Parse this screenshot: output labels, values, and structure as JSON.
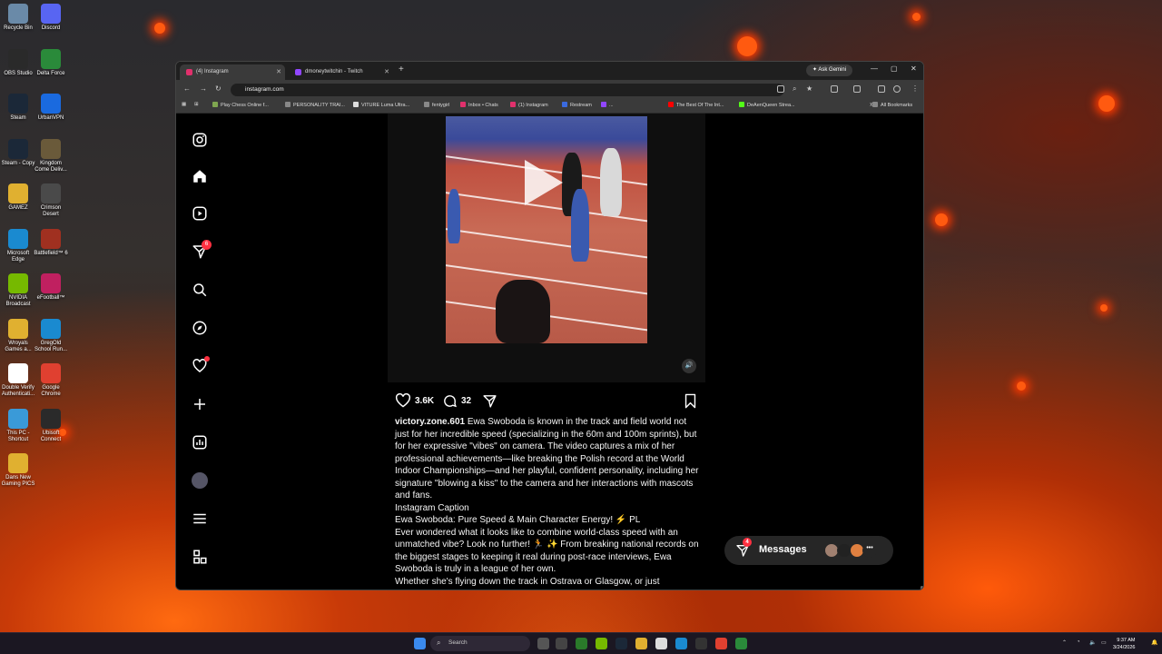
{
  "desktop": {
    "icons": [
      {
        "label": "Recycle Bin",
        "color": "#6a8aa8"
      },
      {
        "label": "Discord",
        "color": "#5865f2"
      },
      {
        "label": "OBS Studio",
        "color": "#2a2a2a"
      },
      {
        "label": "Delta Force",
        "color": "#2a8a3a"
      },
      {
        "label": "Steam",
        "color": "#1b2838"
      },
      {
        "label": "UrbanVPN",
        "color": "#1a6adf"
      },
      {
        "label": "Steam - Copy",
        "color": "#1b2838"
      },
      {
        "label": "Kingdom Come Deliv...",
        "color": "#6a5a3a"
      },
      {
        "label": "GAMEZ",
        "color": "#e0b030"
      },
      {
        "label": "Crimson Desert",
        "color": "#4a4a4a"
      },
      {
        "label": "Microsoft Edge",
        "color": "#1a8ad0"
      },
      {
        "label": "Battlefield™ 6",
        "color": "#a03020"
      },
      {
        "label": "NVIDIA Broadcast",
        "color": "#76b900"
      },
      {
        "label": "eFootball™",
        "color": "#c02060"
      },
      {
        "label": "Wroyals Games a...",
        "color": "#e0b030"
      },
      {
        "label": "GregOld School Run...",
        "color": "#1a8ad0"
      },
      {
        "label": "Double Verify Authenticati...",
        "color": "#ffffff"
      },
      {
        "label": "Google Chrome",
        "color": "#e04030"
      },
      {
        "label": "This PC - Shortcut",
        "color": "#3a9ad8"
      },
      {
        "label": "Ubisoft Connect",
        "color": "#2a2a2a"
      },
      {
        "label": "Dans New Gaming PICS",
        "color": "#e0b030"
      }
    ]
  },
  "browser": {
    "tabs": [
      {
        "title": "(4) Instagram",
        "active": true,
        "favicon_color": "#e1306c"
      },
      {
        "title": "dmoneytwitchin - Twitch",
        "active": false,
        "favicon_color": "#9146ff"
      }
    ],
    "ask_gemini": "Ask Gemini",
    "url": "instagram.com",
    "bookmarks": [
      {
        "label": "Play Chess Online f...",
        "color": "#7fa650"
      },
      {
        "label": "PERSONALITY TRAI...",
        "color": "#888888"
      },
      {
        "label": "VITURE Luma Ultra...",
        "color": "#dddddd"
      },
      {
        "label": "fentygirl",
        "color": "#888888"
      },
      {
        "label": "Inbox • Chats",
        "color": "#e1306c"
      },
      {
        "label": "(1) Instagram",
        "color": "#e1306c"
      },
      {
        "label": "Restream",
        "color": "#3a6adf"
      },
      {
        "label": "...",
        "color": "#9146ff"
      },
      {
        "label": "The Best Of The Int...",
        "color": "#ff0000"
      },
      {
        "label": "DeAenQueen Strea...",
        "color": "#53fc18"
      }
    ],
    "all_bookmarks": "All Bookmarks"
  },
  "instagram": {
    "nav_notification_count": "6",
    "post": {
      "likes": "3.6K",
      "comments": "32",
      "caption_user": "victory.zone.601",
      "caption_body": "Ewa Swoboda is known in the track and field world not just for her incredible speed (specializing in the 60m and 100m sprints), but for her expressive \"vibes\" on camera. The video captures a mix of her professional achievements—like breaking the Polish record at the World Indoor Championships—and her playful, confident personality, including her signature \"blowing a kiss\" to the camera and her interactions with mascots and fans.",
      "caption_heading": "Instagram Caption",
      "caption_title": "Ewa Swoboda: Pure Speed & Main Character Energy! ⚡ PL",
      "caption_p2": "Ever wondered what it looks like to combine world-class speed with an unmatched vibe? Look no further! 🏃 ✨ From breaking national records on the biggest stages to keeping it real during post-race interviews, Ewa Swoboda is truly in a league of her own.",
      "caption_p3": "Whether she's flying down the track in Ostrava or Glasgow, or just"
    },
    "messages": {
      "label": "Messages",
      "count": "4"
    }
  },
  "taskbar": {
    "search_placeholder": "Search",
    "time": "9:37 AM",
    "date": "3/24/2026"
  }
}
